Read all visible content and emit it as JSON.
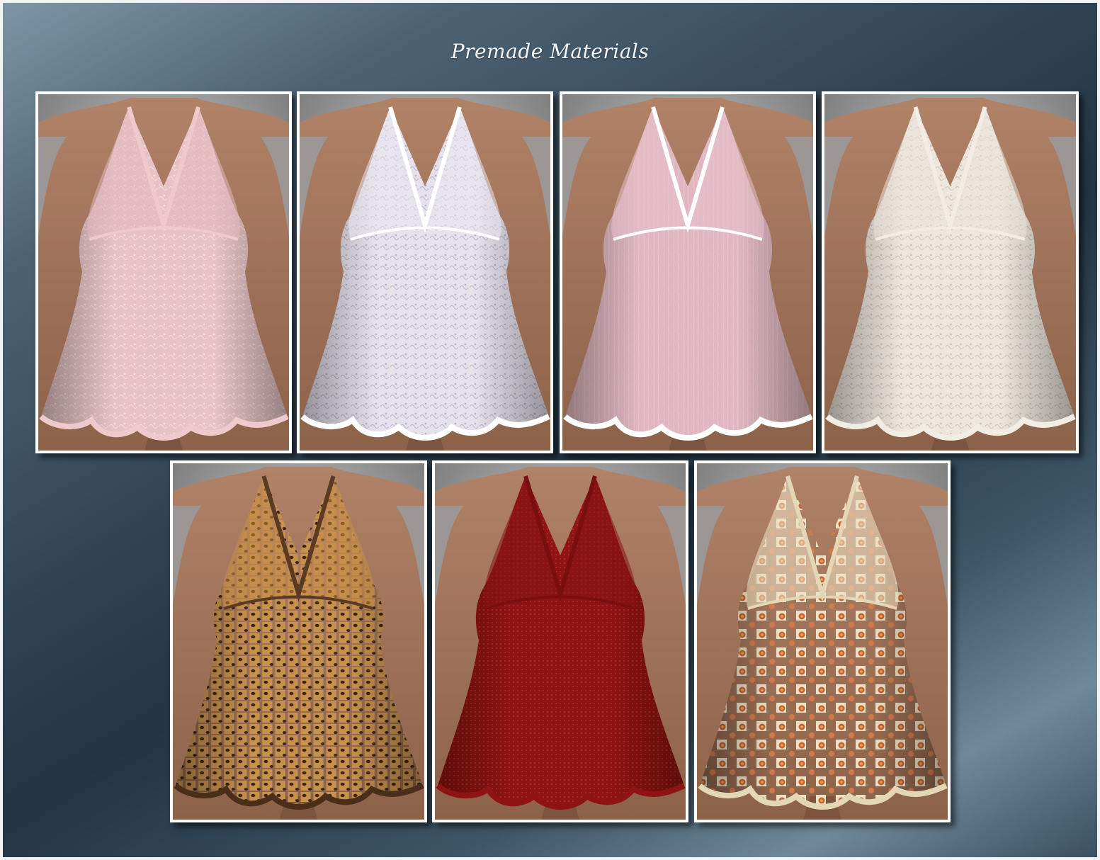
{
  "page": {
    "title": "Premade Materials"
  },
  "materials": [
    {
      "style": "pink-lace",
      "base": "#e7c3c6",
      "pattern": "#f6dedf",
      "trim": "#efc9cb",
      "skirt_trim": "#efc9cb",
      "bodice": "#e2b8bd"
    },
    {
      "style": "white-paisley",
      "base": "#e6e2ec",
      "pattern": "#bdb3cc",
      "trim": "#ffffff",
      "skirt_trim": "#ffffff",
      "bodice": "#e9e6ef"
    },
    {
      "style": "pink-satin",
      "base": "#e0b7c0",
      "pattern": "#e8c6ce",
      "trim": "#ffffff",
      "skirt_trim": "#ffffff",
      "bodice": "#e7c1ca"
    },
    {
      "style": "ivory-lace",
      "base": "#ece6dd",
      "pattern": "#cfc4b6",
      "trim": "#f2ede4",
      "skirt_trim": "#f2ede4",
      "bodice": "#e9e2d8"
    },
    {
      "style": "leopard",
      "base": "#c8914c",
      "pattern": "#3c2513",
      "trim": "#5a3a22",
      "skirt_trim": "#4a2e1a",
      "bodice": "#c48c48"
    },
    {
      "style": "red-dot",
      "base": "#8e1312",
      "pattern": "#b4302b",
      "trim": "#7a0f0f",
      "skirt_trim": "#8e1312",
      "bodice": "#861414"
    },
    {
      "style": "cream-floral",
      "base": "#ece1c4",
      "pattern": "#c8623a",
      "trim": "#e4d7b6",
      "skirt_trim": "#e4d7b6",
      "bodice": "#efe4c6"
    }
  ]
}
